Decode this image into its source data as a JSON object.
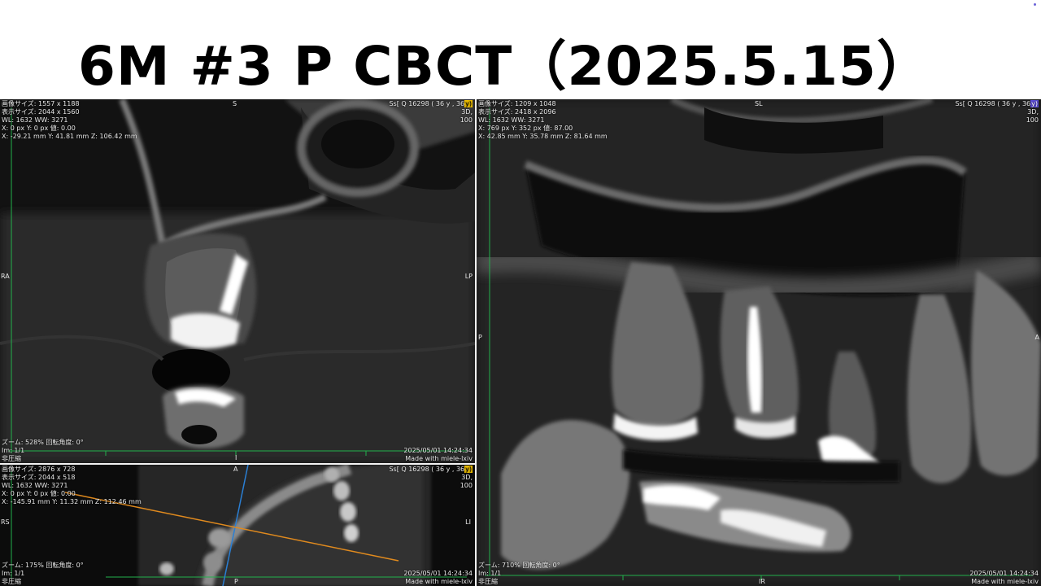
{
  "title": "6M #3 P CBCT（2025.5.15）",
  "colors": {
    "active_border": "#e29a2a",
    "guide_green": "#22b14c",
    "guide_blue": "#2a7fd4",
    "guide_orange": "#e08a1e"
  },
  "sagittal": {
    "info_tl": [
      "画像サイズ: 1557 x 1188",
      "表示サイズ: 2044 x 1560",
      "WL: 1632 WW: 3271",
      "X: 0 px Y: 0 px 値:  0.00",
      "X: -29.21 mm Y: 41.81 mm Z: 106.42 mm"
    ],
    "series_prefix": "Ss[ Q 16298 ( 36 y , 36",
    "series_sel": "y)",
    "info_tr": [
      "3D,",
      "100"
    ],
    "orient": {
      "top": "S",
      "left": "RA",
      "right": "LP",
      "bottom": "I"
    },
    "info_bl": [
      "ズーム: 528% 回転角度: 0°",
      "Im: 1/1",
      "非圧縮"
    ],
    "info_br": [
      "2025/05/01 14:24:34",
      "Made with miele-lxiv"
    ]
  },
  "axial": {
    "info_tl": [
      "画像サイズ: 2876 x 728",
      "表示サイズ: 2044 x 518",
      "WL: 1632 WW: 3271",
      "X: 0 px Y: 0 px 値:  0.00",
      "X: -145.91 mm Y: 11.32 mm Z: 112.46 mm"
    ],
    "series_prefix": "Ss[ Q 16298 ( 36 y , 36",
    "series_sel": "y)",
    "info_tr": [
      "3D,",
      "100"
    ],
    "orient": {
      "top": "A",
      "left": "RS",
      "right": "LI",
      "bottom": "P"
    },
    "info_bl": [
      "ズーム: 175% 回転角度: 0°",
      "Im: 1/1",
      "非圧縮"
    ],
    "info_br": [
      "2025/05/01 14:24:34",
      "Made with miele-lxiv"
    ]
  },
  "coronal": {
    "info_tl": [
      "画像サイズ: 1209 x 1048",
      "表示サイズ: 2418 x 2096",
      "WL: 1632 WW: 3271",
      "X: 769 px Y: 352 px 値:  87.00",
      "X: 42.85 mm Y: 35.78 mm Z: 81.64 mm"
    ],
    "series_prefix": "Ss[ Q 16298 ( 36 y , 36",
    "series_sel": "y)",
    "info_tr": [
      "3D,",
      "100"
    ],
    "orient": {
      "top": "SL",
      "left": "P",
      "right": "A",
      "bottom": "IR"
    },
    "info_bl": [
      "ズーム: 710% 回転角度: 0°",
      "Im: 1/1",
      "非圧縮"
    ],
    "info_br": [
      "2025/05/01 14:24:34",
      "Made with miele-lxiv"
    ]
  }
}
